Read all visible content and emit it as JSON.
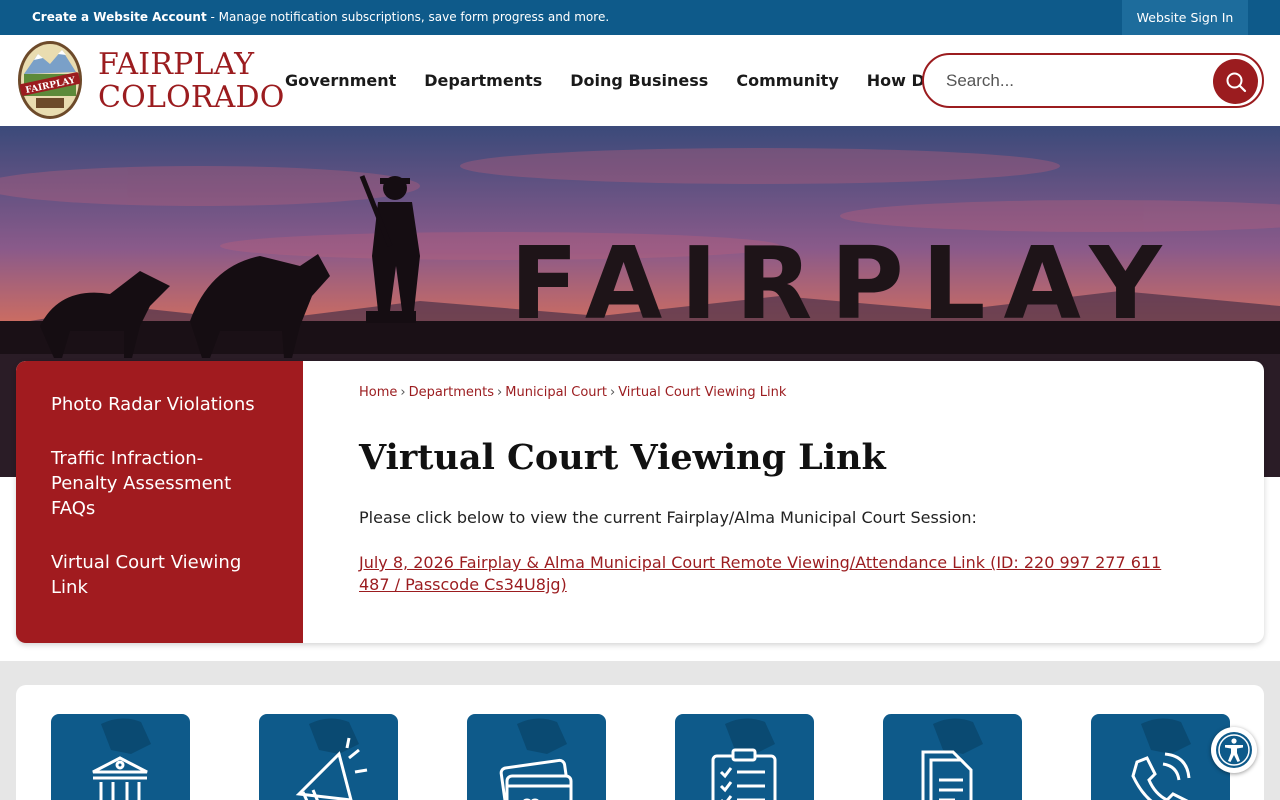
{
  "topbar": {
    "account_link": "Create a Website Account",
    "account_desc": " - Manage notification subscriptions, save form progress and more.",
    "sign_in": "Website Sign In"
  },
  "header": {
    "logo_line1": "FAIRPLAY",
    "logo_line2": "COLORADO",
    "logo_badge_text": "FAIRPLAY",
    "nav": [
      "Government",
      "Departments",
      "Doing Business",
      "Community",
      "How Do I..."
    ],
    "search_placeholder": "Search..."
  },
  "hero": {
    "sign_text": "FAIRPLAY"
  },
  "sidebar": {
    "items": [
      "Photo Radar Violations",
      "Traffic Infraction- Penalty Assessment FAQs",
      "Virtual Court Viewing Link"
    ]
  },
  "breadcrumb": [
    "Home",
    "Departments",
    "Municipal Court",
    "Virtual Court Viewing Link"
  ],
  "page": {
    "title": "Virtual Court Viewing Link",
    "intro": "Please click below to view the current Fairplay/Alma Municipal Court Session:",
    "link": "July 8, 2026 Fairplay & Alma Municipal Court Remote Viewing/Attendance Link (ID: 220 997 277 611 487 / Passcode Cs34U8jg)"
  },
  "quick_links": {
    "icons": [
      "government-building-icon",
      "megaphone-icon",
      "payment-card-icon",
      "checklist-icon",
      "documents-icon",
      "phone-icon"
    ]
  },
  "colors": {
    "brand_blue": "#0e5a8a",
    "brand_red": "#9b1c1f",
    "sidebar_red": "#a11b1f"
  }
}
